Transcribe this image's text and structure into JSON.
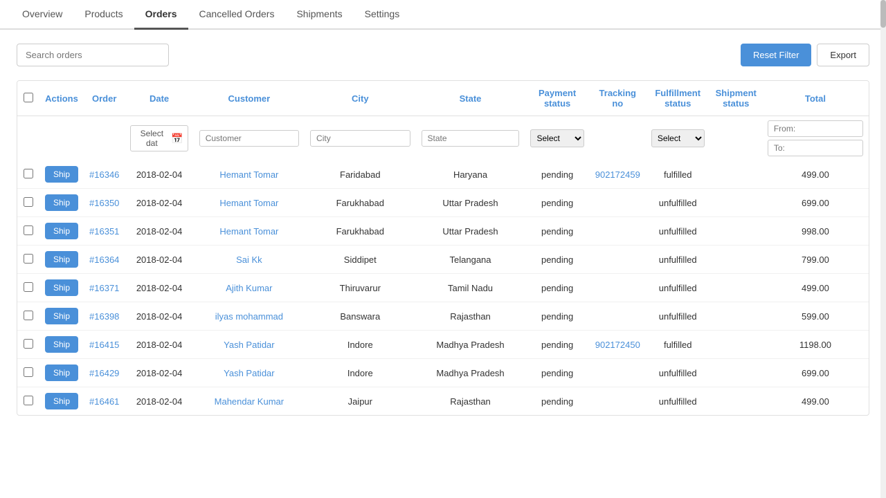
{
  "tabs": [
    {
      "label": "Overview",
      "active": false
    },
    {
      "label": "Products",
      "active": false
    },
    {
      "label": "Orders",
      "active": true
    },
    {
      "label": "Cancelled Orders",
      "active": false
    },
    {
      "label": "Shipments",
      "active": false
    },
    {
      "label": "Settings",
      "active": false
    }
  ],
  "toolbar": {
    "search_placeholder": "Search orders",
    "reset_label": "Reset Filter",
    "export_label": "Export"
  },
  "table": {
    "columns": [
      {
        "key": "actions",
        "label": "Actions"
      },
      {
        "key": "order",
        "label": "Order"
      },
      {
        "key": "date",
        "label": "Date"
      },
      {
        "key": "customer",
        "label": "Customer"
      },
      {
        "key": "city",
        "label": "City"
      },
      {
        "key": "state",
        "label": "State"
      },
      {
        "key": "payment_status",
        "label": "Payment status"
      },
      {
        "key": "tracking_no",
        "label": "Tracking no"
      },
      {
        "key": "fulfillment_status",
        "label": "Fulfillment status"
      },
      {
        "key": "shipment_status",
        "label": "Shipment status"
      },
      {
        "key": "total",
        "label": "Total"
      }
    ],
    "filters": {
      "date_placeholder": "Select dat",
      "customer_placeholder": "Customer",
      "city_placeholder": "City",
      "state_placeholder": "State",
      "payment_select": "Select",
      "fulfillment_select": "Select",
      "from_label": "From:",
      "to_label": "To:"
    },
    "rows": [
      {
        "order": "#16346",
        "date": "2018-02-04",
        "customer": "Hemant Tomar",
        "city": "Faridabad",
        "state": "Haryana",
        "payment_status": "pending",
        "tracking_no": "902172459",
        "fulfillment_status": "fulfilled",
        "shipment_status": "",
        "total": "499.00"
      },
      {
        "order": "#16350",
        "date": "2018-02-04",
        "customer": "Hemant Tomar",
        "city": "Farukhabad",
        "state": "Uttar Pradesh",
        "payment_status": "pending",
        "tracking_no": "",
        "fulfillment_status": "unfulfilled",
        "shipment_status": "",
        "total": "699.00"
      },
      {
        "order": "#16351",
        "date": "2018-02-04",
        "customer": "Hemant Tomar",
        "city": "Farukhabad",
        "state": "Uttar Pradesh",
        "payment_status": "pending",
        "tracking_no": "",
        "fulfillment_status": "unfulfilled",
        "shipment_status": "",
        "total": "998.00"
      },
      {
        "order": "#16364",
        "date": "2018-02-04",
        "customer": "Sai Kk",
        "city": "Siddipet",
        "state": "Telangana",
        "payment_status": "pending",
        "tracking_no": "",
        "fulfillment_status": "unfulfilled",
        "shipment_status": "",
        "total": "799.00"
      },
      {
        "order": "#16371",
        "date": "2018-02-04",
        "customer": "Ajith Kumar",
        "city": "Thiruvarur",
        "state": "Tamil Nadu",
        "payment_status": "pending",
        "tracking_no": "",
        "fulfillment_status": "unfulfilled",
        "shipment_status": "",
        "total": "499.00"
      },
      {
        "order": "#16398",
        "date": "2018-02-04",
        "customer": "ilyas mohammad",
        "city": "Banswara",
        "state": "Rajasthan",
        "payment_status": "pending",
        "tracking_no": "",
        "fulfillment_status": "unfulfilled",
        "shipment_status": "",
        "total": "599.00"
      },
      {
        "order": "#16415",
        "date": "2018-02-04",
        "customer": "Yash Patidar",
        "city": "Indore",
        "state": "Madhya Pradesh",
        "payment_status": "pending",
        "tracking_no": "902172450",
        "fulfillment_status": "fulfilled",
        "shipment_status": "",
        "total": "1198.00"
      },
      {
        "order": "#16429",
        "date": "2018-02-04",
        "customer": "Yash Patidar",
        "city": "Indore",
        "state": "Madhya Pradesh",
        "payment_status": "pending",
        "tracking_no": "",
        "fulfillment_status": "unfulfilled",
        "shipment_status": "",
        "total": "699.00"
      },
      {
        "order": "#16461",
        "date": "2018-02-04",
        "customer": "Mahendar Kumar",
        "city": "Jaipur",
        "state": "Rajasthan",
        "payment_status": "pending",
        "tracking_no": "",
        "fulfillment_status": "unfulfilled",
        "shipment_status": "",
        "total": "499.00"
      }
    ],
    "ship_label": "Ship"
  }
}
